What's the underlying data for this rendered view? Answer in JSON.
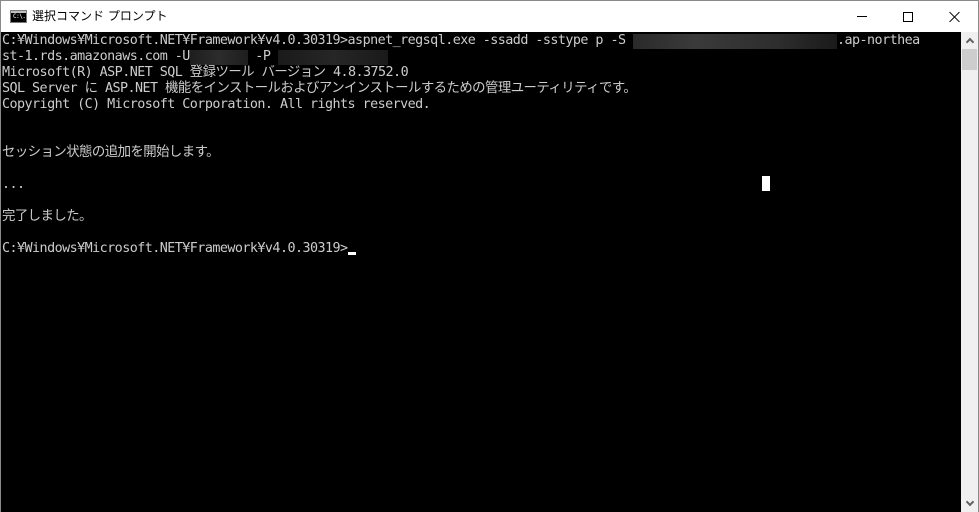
{
  "window": {
    "title": "選択コマンド プロンプト",
    "icon": "cmd-icon",
    "icon_text": "C:\\.",
    "controls": {
      "minimize": "minimize-icon",
      "maximize": "maximize-icon",
      "close": "close-icon"
    }
  },
  "console": {
    "lines": [
      {
        "prefix": "C:¥Windows¥Microsoft.NET¥Framework¥v4.0.30319>aspnet_regsql.exe -ssadd -sstype p -S ",
        "suffix": ".ap-northea"
      },
      {
        "prefix": "st-1.rds.amazonaws.com -U",
        "middle": " -P ",
        "suffix": ""
      },
      {
        "text": "Microsoft(R) ASP.NET SQL 登録ツール バージョン 4.8.3752.0"
      },
      {
        "text": "SQL Server に ASP.NET 機能をインストールおよびアンインストールするための管理ユーティリティです。"
      },
      {
        "text": "Copyright (C) Microsoft Corporation. All rights reserved."
      },
      {
        "text": ""
      },
      {
        "text": ""
      },
      {
        "text": "セッション状態の追加を開始します。"
      },
      {
        "text": ""
      },
      {
        "text": "..."
      },
      {
        "text": ""
      },
      {
        "text": "完了しました。"
      },
      {
        "text": ""
      },
      {
        "text": "C:¥Windows¥Microsoft.NET¥Framework¥v4.0.30319>"
      }
    ],
    "redacted": [
      "server-name",
      "user-name",
      "password"
    ],
    "colors": {
      "background": "#000000",
      "foreground": "#cccccc",
      "cursor": "#ffffff"
    }
  },
  "scrollbar": {
    "up_icon": "chevron-up-icon",
    "down_icon": "chevron-down-icon",
    "position": 0
  }
}
